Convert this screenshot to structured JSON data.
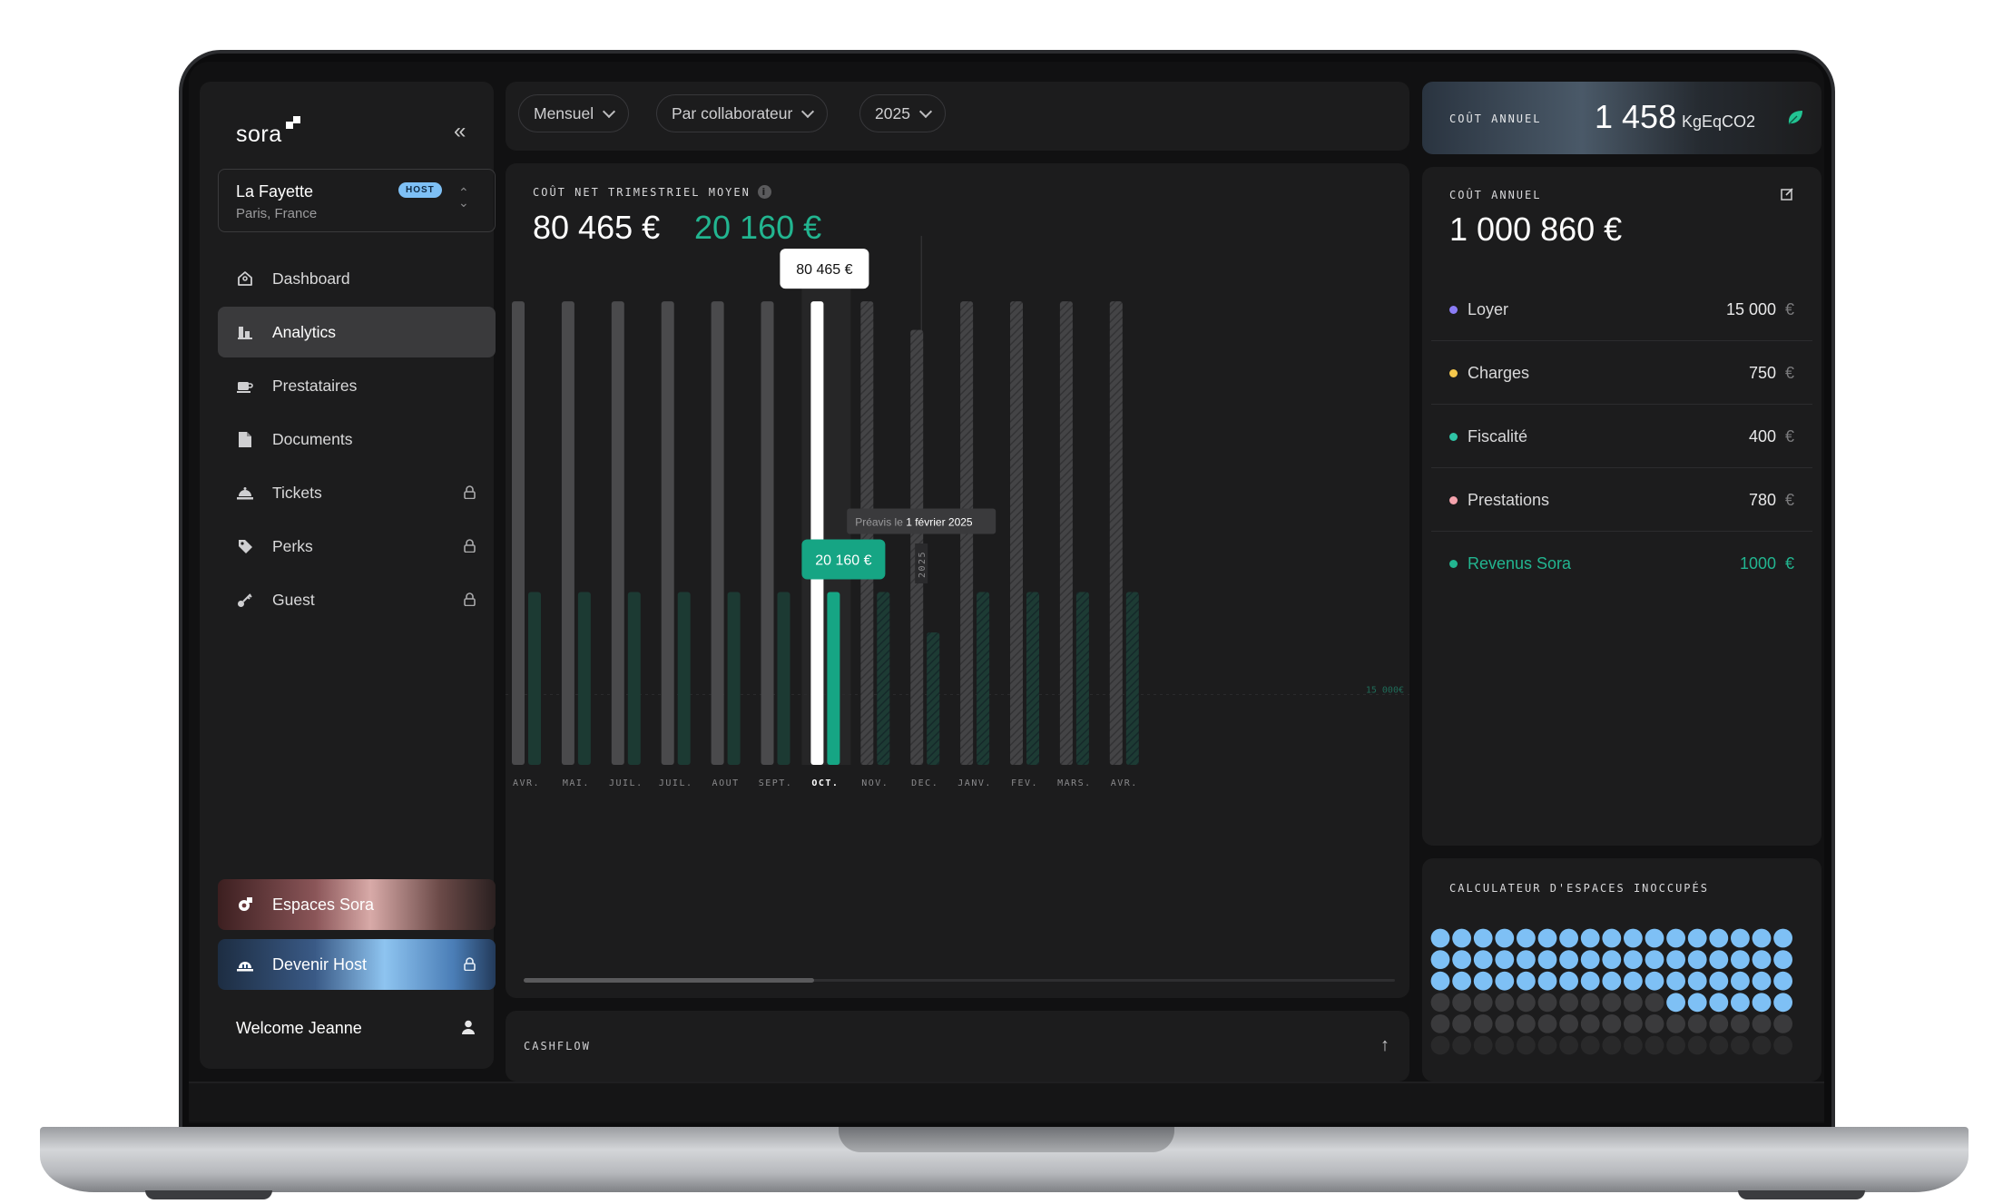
{
  "brand": {
    "name": "sora"
  },
  "site": {
    "name": "La Fayette",
    "location": "Paris, France",
    "badge": "HOST"
  },
  "nav": [
    {
      "label": "Dashboard",
      "icon": "home-icon",
      "active": false,
      "locked": false
    },
    {
      "label": "Analytics",
      "icon": "chart-icon",
      "active": true,
      "locked": false
    },
    {
      "label": "Prestataires",
      "icon": "coffee-icon",
      "active": false,
      "locked": false
    },
    {
      "label": "Documents",
      "icon": "document-icon",
      "active": false,
      "locked": false
    },
    {
      "label": "Tickets",
      "icon": "bell-icon",
      "active": false,
      "locked": true
    },
    {
      "label": "Perks",
      "icon": "tag-icon",
      "active": false,
      "locked": true
    },
    {
      "label": "Guest",
      "icon": "key-icon",
      "active": false,
      "locked": true
    }
  ],
  "promos": {
    "espaces": {
      "label": "Espaces Sora",
      "icon": "sora-spaces-icon"
    },
    "host": {
      "label": "Devenir Host",
      "icon": "host-icon"
    }
  },
  "user": {
    "welcome": "Welcome Jeanne"
  },
  "filters": {
    "period": "Mensuel",
    "grouping": "Par collaborateur",
    "year": "2025"
  },
  "chart_panel": {
    "title": "COÛT NET TRIMESTRIEL MOYEN",
    "kpi_cost": "80 465 €",
    "kpi_revenue": "20 160 €"
  },
  "chart_data": {
    "type": "bar",
    "categories": [
      "AVR.",
      "MAI.",
      "JUIL.",
      "JUIL.",
      "AOUT",
      "SEPT.",
      "OCT.",
      "NOV.",
      "DEC.",
      "JANV.",
      "FEV.",
      "MARS.",
      "AVR."
    ],
    "series": [
      {
        "values": [
          80465,
          80465,
          80465,
          80465,
          80465,
          80465,
          80465,
          80465,
          75500,
          80465,
          80465,
          80465,
          80465
        ]
      },
      {
        "values": [
          30000,
          30000,
          30000,
          30000,
          30000,
          30000,
          30000,
          30000,
          23000,
          30000,
          30000,
          30000,
          30000
        ]
      }
    ],
    "ylim": [
      0,
      86000
    ],
    "highlight_index": 6,
    "forecast_from_index": 7,
    "tooltip_top": "80 465 €",
    "tooltip_bottom": "20 160 €",
    "marker_label_prefix": "Préavis le",
    "marker_label_date": "1 février 2025",
    "marker_year": "2025",
    "reference_label": "15 000€",
    "colors": {
      "cost": "#4a4a4c",
      "revenue": "#1c3a33",
      "highlight_cost": "#ffffff",
      "highlight_revenue": "#16a584",
      "accent": "#22b590"
    }
  },
  "cashflow": {
    "label": "CASHFLOW"
  },
  "co2": {
    "label": "COÛT ANNUEL",
    "value": "1 458",
    "unit": "KgEqCO2"
  },
  "annual_cost": {
    "label": "COÛT ANNUEL",
    "total": "1 000 860 €",
    "items": [
      {
        "name": "Loyer",
        "value": "15 000",
        "currency": "€",
        "color": "#8b7cf6"
      },
      {
        "name": "Charges",
        "value": "750",
        "currency": "€",
        "color": "#f5c84c"
      },
      {
        "name": "Fiscalité",
        "value": "400",
        "currency": "€",
        "color": "#2fc4a6"
      },
      {
        "name": "Prestations",
        "value": "780",
        "currency": "€",
        "color": "#f5a3ad"
      },
      {
        "name": "Revenus Sora",
        "value": "1000",
        "currency": "€",
        "color": "#22b590"
      }
    ]
  },
  "calculator": {
    "label": "CALCULATEUR D'ESPACES INOCCUPÉS",
    "columns": 17,
    "rows": 6,
    "occupied_full_rows": 3,
    "occupied_partial_count": 6,
    "colors": {
      "occupied": "#7ec0f5",
      "empty": "#3a3a3c"
    }
  }
}
